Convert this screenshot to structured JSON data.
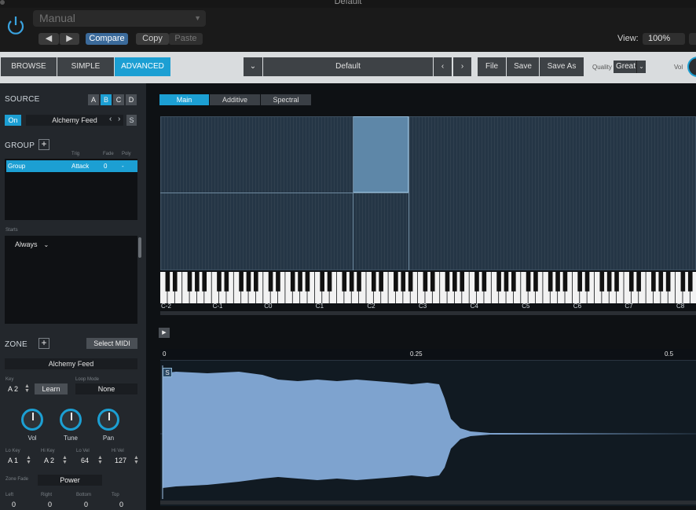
{
  "window": {
    "title": "Default"
  },
  "host": {
    "preset": "Manual",
    "prev": "◀",
    "next": "▶",
    "compare": "Compare",
    "copy": "Copy",
    "paste": "Paste",
    "view_label": "View:",
    "view_value": "100%"
  },
  "toolbar": {
    "browse": "BROWSE",
    "simple": "SIMPLE",
    "advanced": "ADVANCED",
    "preset_name": "Default",
    "prev": "‹",
    "next": "›",
    "file": "File",
    "save": "Save",
    "save_as": "Save As",
    "quality_label": "Quality",
    "quality_value": "Great",
    "vol_label": "Vol"
  },
  "source": {
    "title": "SOURCE",
    "slots": [
      "A",
      "B",
      "C",
      "D"
    ],
    "on": "On",
    "name": "Alchemy Feed",
    "s": "S"
  },
  "group": {
    "title": "GROUP",
    "cols": {
      "trig": "Trig",
      "fade": "Fade",
      "poly": "Poly"
    },
    "row": {
      "name": "Group",
      "trig": "Attack",
      "fade": "0",
      "poly": "-"
    },
    "starts_label": "Starts",
    "starts_value": "Always"
  },
  "zone": {
    "title": "ZONE",
    "select_midi": "Select MIDI",
    "source": "Alchemy Feed",
    "key_label": "Key",
    "key_value": "A 2",
    "learn": "Learn",
    "loop_label": "Loop Mode",
    "loop_value": "None",
    "knobs": [
      "Vol",
      "Tune",
      "Pan"
    ],
    "lo_key_label": "Lo Key",
    "lo_key": "A 1",
    "hi_key_label": "Hi Key",
    "hi_key": "A 2",
    "lo_vel_label": "Lo Vel",
    "lo_vel": "64",
    "hi_vel_label": "Hi Vel",
    "hi_vel": "127",
    "fade_label": "Zone Fade",
    "fade_value": "Power",
    "left_label": "Left",
    "left": "0",
    "right_label": "Right",
    "right": "0",
    "bottom_label": "Bottom",
    "bottom": "0",
    "top_label": "Top",
    "top": "0"
  },
  "tabs": [
    "Main",
    "Additive",
    "Spectral"
  ],
  "keyboard": {
    "labels": [
      "C-2",
      "C-1",
      "C0",
      "C1",
      "C2",
      "C3",
      "C4",
      "C5",
      "C6",
      "C7",
      "C8"
    ]
  },
  "wave": {
    "ruler": [
      "0",
      "0.25",
      "0.5"
    ],
    "start_marker": "S",
    "play": "▶"
  },
  "colors": {
    "accent": "#1c9fd3",
    "zone_fill": "#253646",
    "wave_fill": "#7ea3cf"
  }
}
